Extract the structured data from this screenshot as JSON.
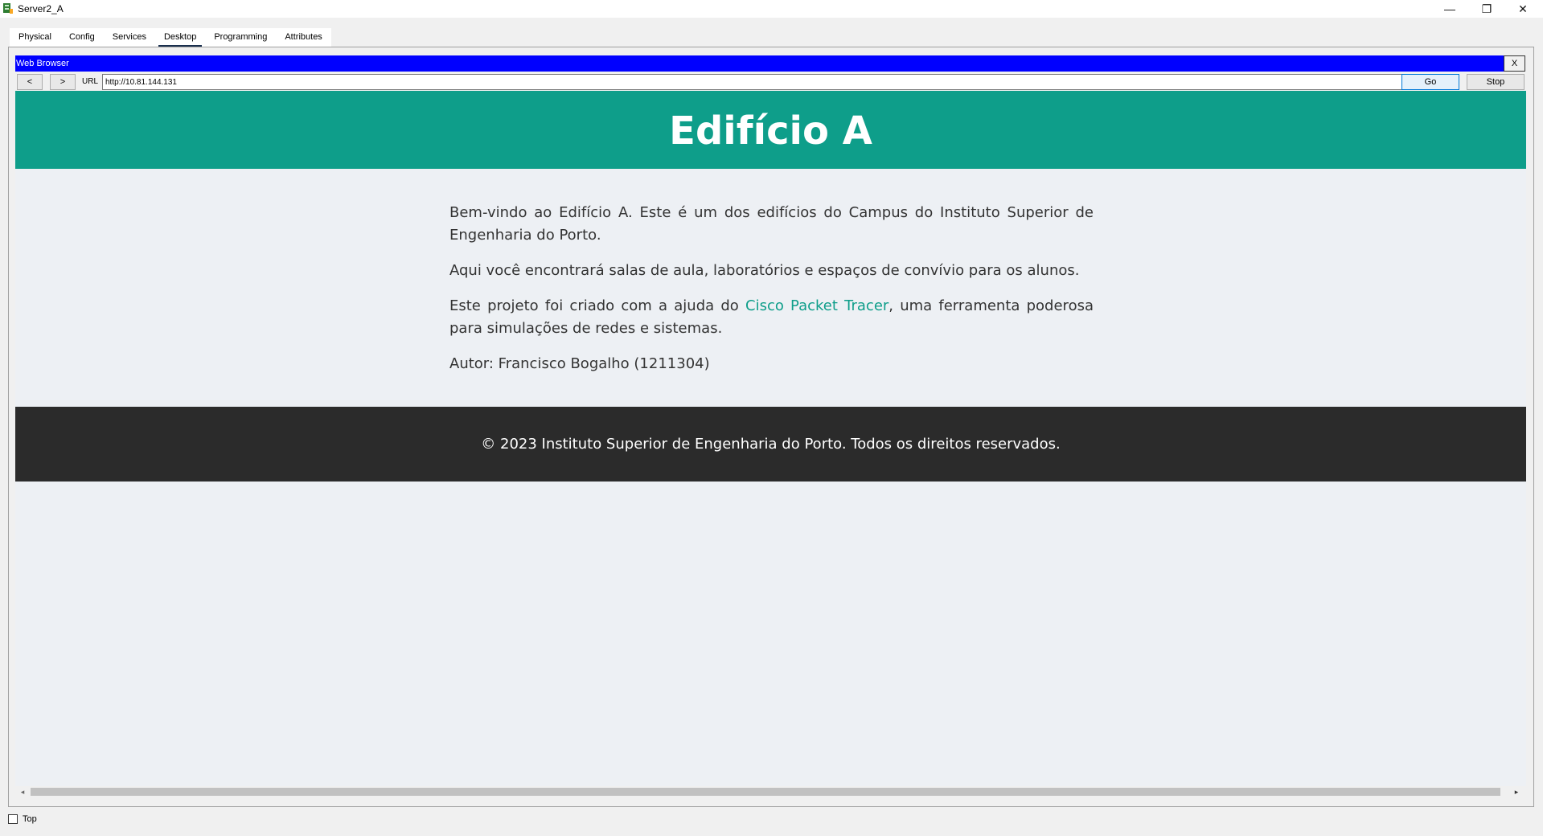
{
  "window": {
    "title": "Server2_A",
    "controls": {
      "minimize": "—",
      "maximize": "❐",
      "close": "✕"
    }
  },
  "tabs": [
    {
      "label": "Physical",
      "active": false
    },
    {
      "label": "Config",
      "active": false
    },
    {
      "label": "Services",
      "active": false
    },
    {
      "label": "Desktop",
      "active": true
    },
    {
      "label": "Programming",
      "active": false
    },
    {
      "label": "Attributes",
      "active": false
    }
  ],
  "browser": {
    "title": "Web Browser",
    "close_label": "X",
    "back_label": "<",
    "forward_label": ">",
    "url_label": "URL",
    "url": "http://10.81.144.131",
    "go_label": "Go",
    "stop_label": "Stop"
  },
  "page": {
    "header_title": "Edifício A",
    "paragraph1": "Bem-vindo ao Edifício A. Este é um dos edifícios do Campus do Instituto Superior de Engenharia do Porto.",
    "paragraph2": "Aqui você encontrará salas de aula, laboratórios e espaços de convívio para os alunos.",
    "paragraph3_before": "Este projeto foi criado com a ajuda do ",
    "paragraph3_link": "Cisco Packet Tracer",
    "paragraph3_after": ", uma ferramenta poderosa para simulações de redes e sistemas.",
    "author": "Autor: Francisco Bogalho (1211304)",
    "footer": "© 2023 Instituto Superior de Engenharia do Porto. Todos os direitos reservados."
  },
  "scrollbar": {
    "left_arrow": "◂",
    "right_arrow": "▸"
  },
  "bottom": {
    "top_label": "Top",
    "top_checked": false
  },
  "colors": {
    "header_bg": "#0e9e8a",
    "footer_bg": "#2b2b2b",
    "browser_titlebar": "#0000ff",
    "link": "#0e9e8a",
    "page_bg": "#edf0f4"
  }
}
